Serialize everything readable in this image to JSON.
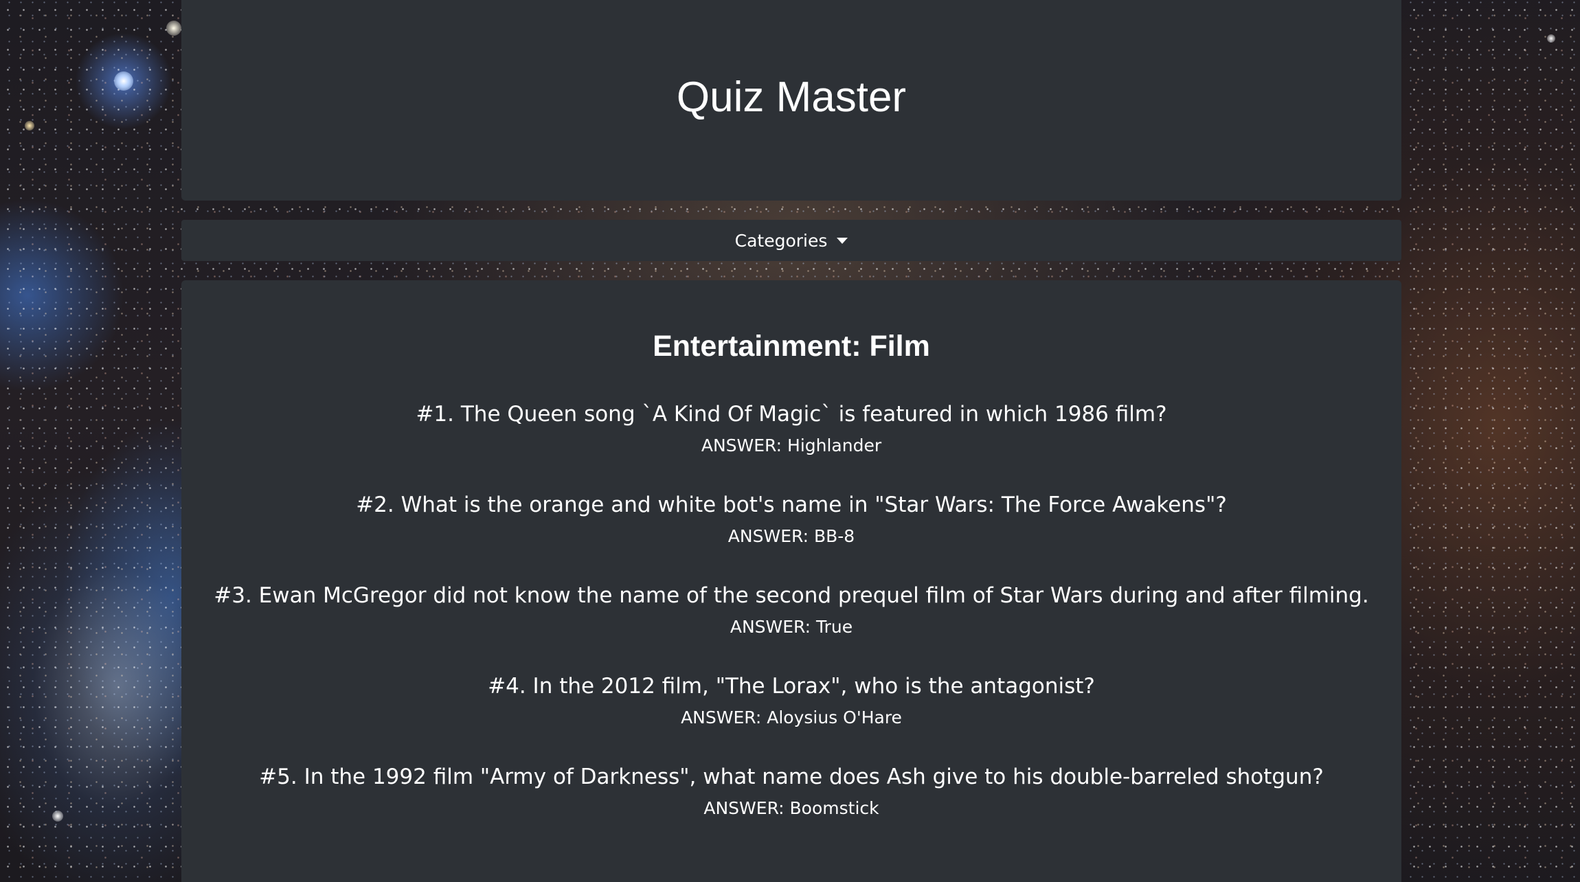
{
  "app": {
    "title": "Quiz Master"
  },
  "nav": {
    "categories_label": "Categories"
  },
  "quiz": {
    "category": "Entertainment: Film",
    "questions": [
      {
        "number": "#1.",
        "text": "#1. The Queen song `A Kind Of Magic` is featured in which 1986 film?",
        "answer": "ANSWER: Highlander"
      },
      {
        "number": "#2.",
        "text": "#2. What is the orange and white bot's name in \"Star Wars: The Force Awakens\"?",
        "answer": "ANSWER: BB-8"
      },
      {
        "number": "#3.",
        "text": "#3. Ewan McGregor did not know the name of the second prequel film of Star Wars during and after filming.",
        "answer": "ANSWER: True"
      },
      {
        "number": "#4.",
        "text": "#4. In the 2012 film, \"The Lorax\", who is the antagonist?",
        "answer": "ANSWER: Aloysius O'Hare"
      },
      {
        "number": "#5.",
        "text": "#5. In the 1992 film \"Army of Darkness\", what name does Ash give to his double-barreled shotgun?",
        "answer": "ANSWER: Boomstick"
      }
    ]
  },
  "colors": {
    "panel_background": "#2d3136",
    "text": "#ffffff"
  }
}
